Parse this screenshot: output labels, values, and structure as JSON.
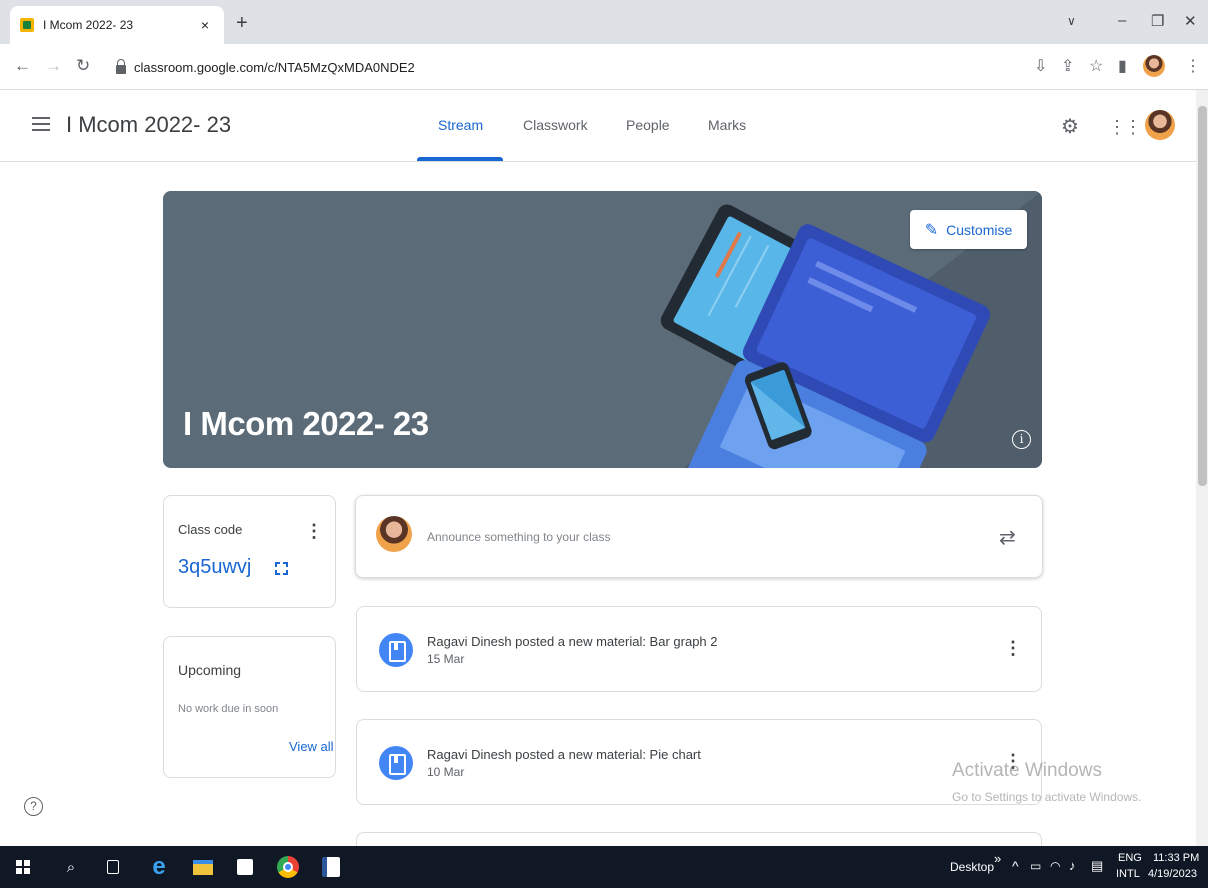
{
  "browser": {
    "tab_title": "I Mcom 2022- 23",
    "url": "classroom.google.com/c/NTA5MzQxMDA0NDE2"
  },
  "header": {
    "class_title": "I Mcom 2022- 23",
    "tabs": [
      {
        "label": "Stream",
        "active": true
      },
      {
        "label": "Classwork",
        "active": false
      },
      {
        "label": "People",
        "active": false
      },
      {
        "label": "Marks",
        "active": false
      }
    ]
  },
  "banner": {
    "title": "I Mcom 2022- 23",
    "customise_label": "Customise"
  },
  "class_code": {
    "label": "Class code",
    "value": "3q5uwvj"
  },
  "upcoming": {
    "title": "Upcoming",
    "subtitle": "No work due in soon",
    "link": "View all"
  },
  "announce": {
    "placeholder": "Announce something to your class"
  },
  "posts": [
    {
      "title": "Ragavi Dinesh posted a new material: Bar graph 2",
      "date": "15 Mar"
    },
    {
      "title": "Ragavi Dinesh posted a new material: Pie chart",
      "date": "10 Mar"
    }
  ],
  "watermark": {
    "title": "Activate Windows",
    "subtitle": "Go to Settings to activate Windows."
  },
  "taskbar": {
    "desktop_label": "Desktop",
    "lang": "ENG",
    "layout": "INTL",
    "time": "11:33 PM",
    "date": "4/19/2023"
  },
  "colors": {
    "accent": "#1967d2",
    "banner": "#5b6b78",
    "taskbar": "#101826"
  }
}
